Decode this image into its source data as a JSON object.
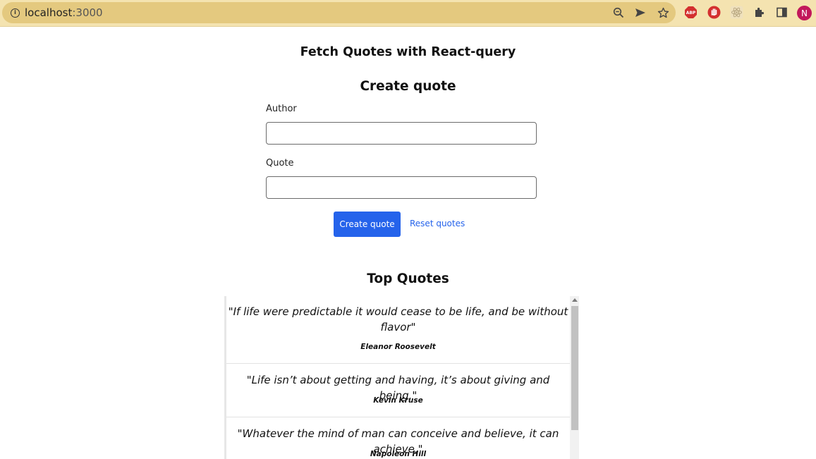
{
  "browser": {
    "url_host": "localhost",
    "url_rest": ":3000",
    "profile_initial": "N",
    "abp_label": "ABP"
  },
  "page": {
    "title": "Fetch Quotes with React-query",
    "form": {
      "heading": "Create quote",
      "author_label": "Author",
      "author_value": "",
      "quote_label": "Quote",
      "quote_value": "",
      "create_button": "Create quote",
      "reset_link": "Reset quotes"
    },
    "top_quotes": {
      "heading": "Top Quotes",
      "items": [
        {
          "text_line1": "\"If life were predictable it would cease to be life, and be without",
          "text_line2": "flavor\"",
          "author": "Eleanor Roosevelt"
        },
        {
          "text_line1": "\"Life isn’t about getting and having, it’s about giving and being.\"",
          "author": "Kevin Kruse"
        },
        {
          "text_line1": "\"Whatever the mind of man can conceive and believe, it can achieve.\"",
          "author": "Napoleon Hill"
        }
      ]
    }
  },
  "colors": {
    "toolbar": "#f4e3b0",
    "omnibox": "#e4c97f",
    "primary": "#2563eb",
    "profile": "#c2185b"
  }
}
